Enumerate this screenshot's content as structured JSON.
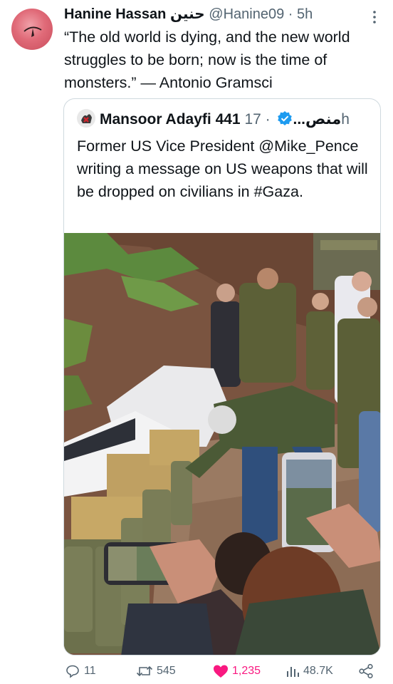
{
  "tweet": {
    "display_name": "Hanine Hassan حنين",
    "handle_time": " @Hanine09 · 5h",
    "text": "“The old world is dying, and the new world struggles to be born; now is the time of monsters.” — Antonio Gramsci"
  },
  "quoted": {
    "display_name": "Mansoor Adayfi 441 منص...",
    "time": " · 17h",
    "text": "Former US Vice President @Mike_Pence writing a message on US weapons that will be dropped on civilians in #Gaza."
  },
  "actions": {
    "replies": "11",
    "reposts": "545",
    "likes": "1,235",
    "views": "48.7K"
  },
  "icons": [
    "more-icon",
    "verified-badge-icon",
    "reply-icon",
    "repost-icon",
    "like-icon",
    "views-icon",
    "share-icon"
  ],
  "colors": {
    "text": "#0f1419",
    "secondary": "#536471",
    "verified": "#1d9bf0",
    "like": "#f91880",
    "border": "#cfd9de"
  }
}
